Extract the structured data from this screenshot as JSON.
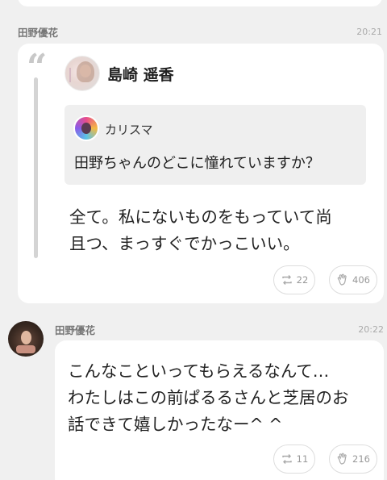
{
  "first_message": {
    "sender": "田野優花",
    "time": "20:21",
    "quoted_post": {
      "author": "島崎 遥香",
      "inner_quote": {
        "author": "カリスマ",
        "text": "田野ちゃんのどこに憧れていますか？"
      },
      "reply_line1": "全て。私にないものをもっていて尚",
      "reply_line2": "且つ、まっすぐでかっこいい。"
    },
    "retweet_count": "22",
    "clap_count": "406"
  },
  "second_message": {
    "sender": "田野優花",
    "time": "20:22",
    "text_line1": "こんなこといってもらえるなんて…",
    "text_line2": "わたしはこの前ぱるるさんと芝居のお",
    "text_line3": "話できて嬉しかったなー^ ^",
    "retweet_count": "11",
    "clap_count": "216"
  },
  "icons": {
    "quote": "quote-icon",
    "retweet": "retweet-icon",
    "clap": "clap-icon"
  },
  "colors": {
    "background": "#f0f0f0",
    "card": "#ffffff",
    "inner_quote": "#efefef",
    "muted": "#999999"
  }
}
